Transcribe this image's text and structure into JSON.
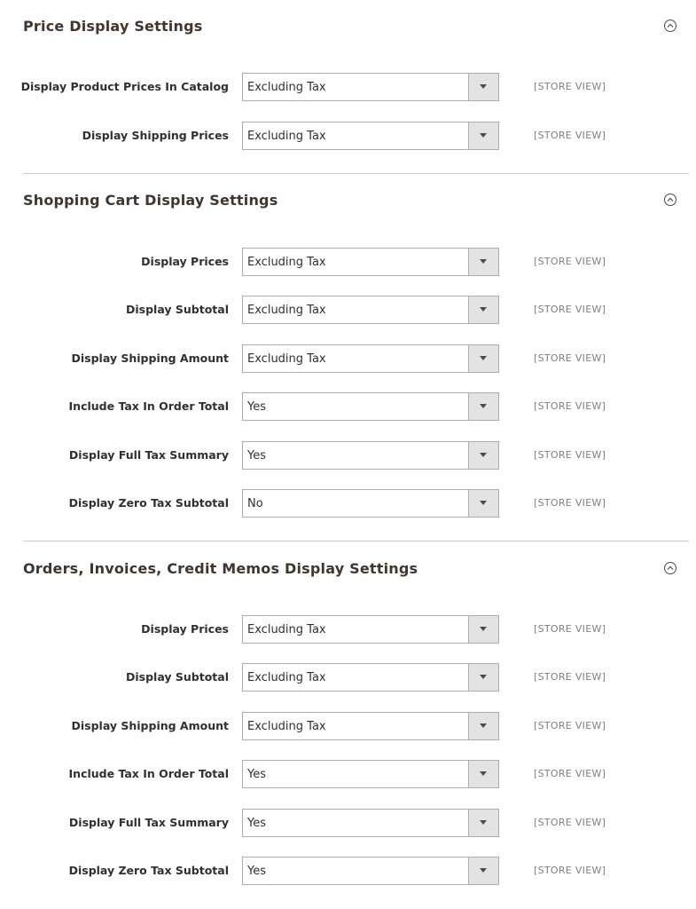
{
  "scope_label": "[STORE VIEW]",
  "sections": [
    {
      "title": "Price Display Settings",
      "rows": [
        {
          "label": "Display Product Prices In Catalog",
          "value": "Excluding Tax"
        },
        {
          "label": "Display Shipping Prices",
          "value": "Excluding Tax"
        }
      ]
    },
    {
      "title": "Shopping Cart Display Settings",
      "rows": [
        {
          "label": "Display Prices",
          "value": "Excluding Tax"
        },
        {
          "label": "Display Subtotal",
          "value": "Excluding Tax"
        },
        {
          "label": "Display Shipping Amount",
          "value": "Excluding Tax"
        },
        {
          "label": "Include Tax In Order Total",
          "value": "Yes"
        },
        {
          "label": "Display Full Tax Summary",
          "value": "Yes"
        },
        {
          "label": "Display Zero Tax Subtotal",
          "value": "No"
        }
      ]
    },
    {
      "title": "Orders, Invoices, Credit Memos Display Settings",
      "rows": [
        {
          "label": "Display Prices",
          "value": "Excluding Tax"
        },
        {
          "label": "Display Subtotal",
          "value": "Excluding Tax"
        },
        {
          "label": "Display Shipping Amount",
          "value": "Excluding Tax"
        },
        {
          "label": "Include Tax In Order Total",
          "value": "Yes"
        },
        {
          "label": "Display Full Tax Summary",
          "value": "Yes"
        },
        {
          "label": "Display Zero Tax Subtotal",
          "value": "Yes"
        }
      ]
    }
  ],
  "icons": {
    "collapse": "chevron-up-circle-icon",
    "dropdown": "caret-down-icon"
  },
  "colors": {
    "title": "#41362f",
    "label": "#303030",
    "scope": "#808080",
    "border": "#adadad",
    "arrow_bg": "#e3e3e3",
    "divider": "#cccccc"
  }
}
